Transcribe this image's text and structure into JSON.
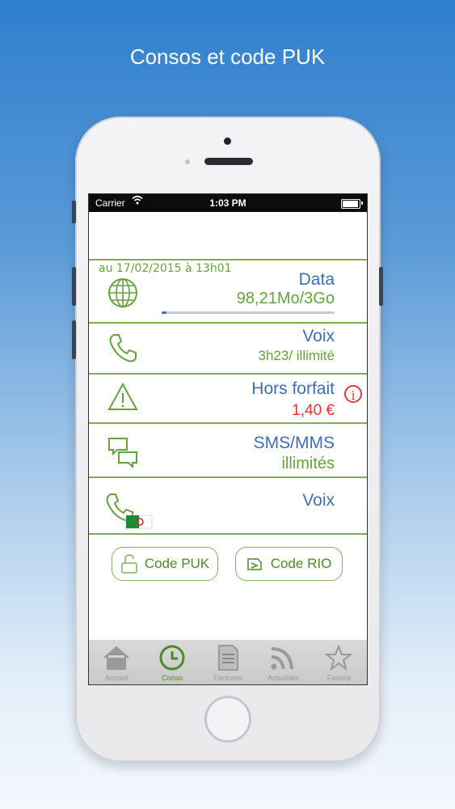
{
  "headline": "Consos et code PUK",
  "status_bar": {
    "carrier": "Carrier",
    "time": "1:03 PM"
  },
  "data_row": {
    "date": "au 17/02/2015 à 13h01",
    "title": "Data",
    "value": "98,21Mo/3Go",
    "progress": 0.03
  },
  "voice_row": {
    "title": "Voix",
    "value": "3h23/ illimité"
  },
  "extra_row": {
    "title": "Hors forfait",
    "value": "1,40 €",
    "info_icon": "info-icon"
  },
  "sms_row": {
    "title": "SMS/MMS",
    "value": "illimités"
  },
  "intl_row": {
    "title": "Voix"
  },
  "buttons": {
    "puk": "Code PUK",
    "rio": "Code RIO"
  },
  "tabbar": {
    "tabs": [
      {
        "label": "Accueil",
        "icon": "home-icon"
      },
      {
        "label": "Conso",
        "icon": "clock-icon"
      },
      {
        "label": "Factures",
        "icon": "document-icon"
      },
      {
        "label": "Actualités",
        "icon": "rss-icon"
      },
      {
        "label": "Favoris",
        "icon": "star-icon"
      }
    ]
  },
  "colors": {
    "accent_green": "#65a33f",
    "title_blue": "#3e6fb4",
    "alert_red": "#e23a2f"
  }
}
